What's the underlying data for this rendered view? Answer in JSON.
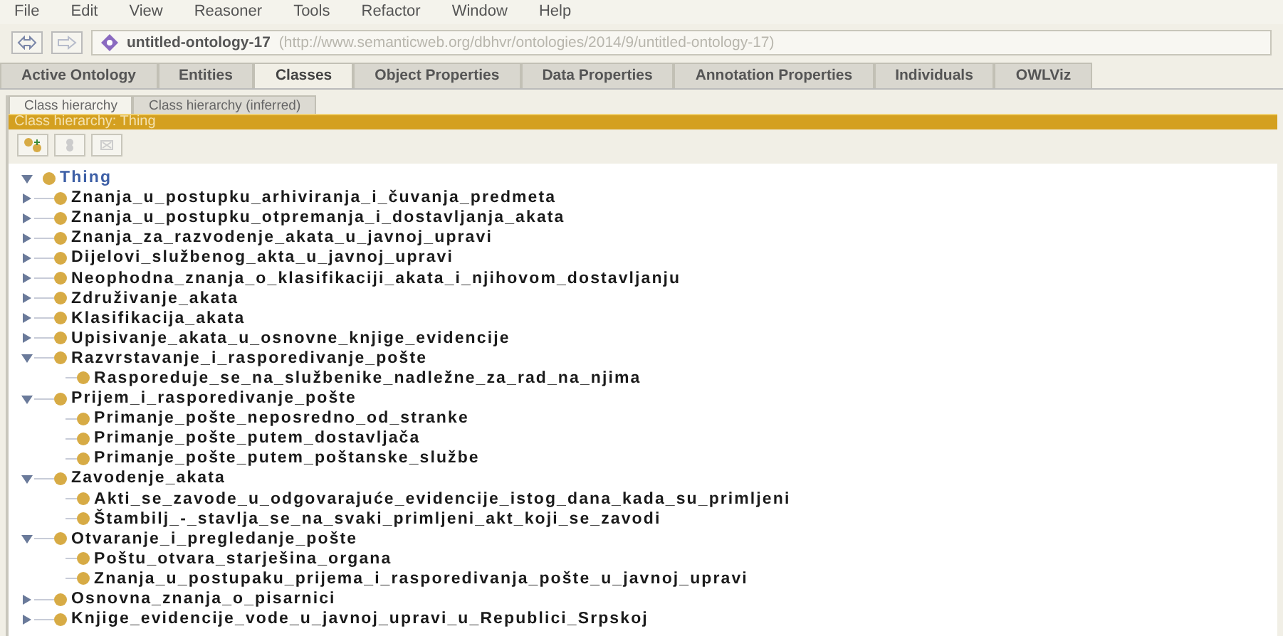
{
  "menu": [
    "File",
    "Edit",
    "View",
    "Reasoner",
    "Tools",
    "Refactor",
    "Window",
    "Help"
  ],
  "ontology_bar": {
    "name": "untitled-ontology-17",
    "iri": "(http://www.semanticweb.org/dbhvr/ontologies/2014/9/untitled-ontology-17)"
  },
  "tabs": [
    {
      "label": "Active Ontology",
      "selected": false
    },
    {
      "label": "Entities",
      "selected": false
    },
    {
      "label": "Classes",
      "selected": true
    },
    {
      "label": "Object Properties",
      "selected": false
    },
    {
      "label": "Data Properties",
      "selected": false
    },
    {
      "label": "Annotation Properties",
      "selected": false
    },
    {
      "label": "Individuals",
      "selected": false
    },
    {
      "label": "OWLViz",
      "selected": false
    }
  ],
  "subtabs": [
    {
      "label": "Class hierarchy",
      "selected": true
    },
    {
      "label": "Class hierarchy (inferred)",
      "selected": false
    }
  ],
  "panel_header": "Class hierarchy: Thing",
  "tree": {
    "label": "Thing",
    "expanded": true,
    "children": [
      {
        "label": "Znanja_u_postupku_arhiviranja_i_čuvanja_predmeta",
        "expanded": false
      },
      {
        "label": "Znanja_u_postupku_otpremanja_i_dostavljanja_akata",
        "expanded": false
      },
      {
        "label": "Znanja_za_razvodenje_akata_u_javnoj_upravi",
        "expanded": false
      },
      {
        "label": "Dijelovi_službenog_akta_u_javnoj_upravi",
        "expanded": false
      },
      {
        "label": "Neophodna_znanja_o_klasifikaciji_akata_i_njihovom_dostavljanju",
        "expanded": false
      },
      {
        "label": "Združivanje_akata",
        "expanded": false
      },
      {
        "label": "Klasifikacija_akata",
        "expanded": false
      },
      {
        "label": "Upisivanje_akata_u_osnovne_knjige_evidencije",
        "expanded": false
      },
      {
        "label": "Razvrstavanje_i_rasporedivanje_pošte",
        "expanded": true,
        "children": [
          {
            "label": "Rasporeduje_se_na_službenike_nadležne_za_rad_na_njima"
          }
        ]
      },
      {
        "label": "Prijem_i_rasporedivanje_pošte",
        "expanded": true,
        "children": [
          {
            "label": "Primanje_pošte_neposredno_od_stranke"
          },
          {
            "label": "Primanje_pošte_putem_dostavljača"
          },
          {
            "label": "Primanje_pošte_putem_poštanske_službe"
          }
        ]
      },
      {
        "label": "Zavodenje_akata",
        "expanded": true,
        "children": [
          {
            "label": "Akti_se_zavode_u_odgovarajuće_evidencije_istog_dana_kada_su_primljeni"
          },
          {
            "label": "Štambilj_-_stavlja_se_na_svaki_primljeni_akt_koji_se_zavodi"
          }
        ]
      },
      {
        "label": "Otvaranje_i_pregledanje_pošte",
        "expanded": true,
        "children": [
          {
            "label": "Poštu_otvara_starješina_organa"
          },
          {
            "label": "Znanja_u_postupaku_prijema_i_rasporedivanja_pošte_u_javnoj_upravi"
          }
        ]
      },
      {
        "label": "Osnovna_znanja_o_pisarnici",
        "expanded": false
      },
      {
        "label": "Knjige_evidencije_vode_u_javnoj_upravi_u_Republici_Srpskoj",
        "expanded": false
      }
    ]
  }
}
